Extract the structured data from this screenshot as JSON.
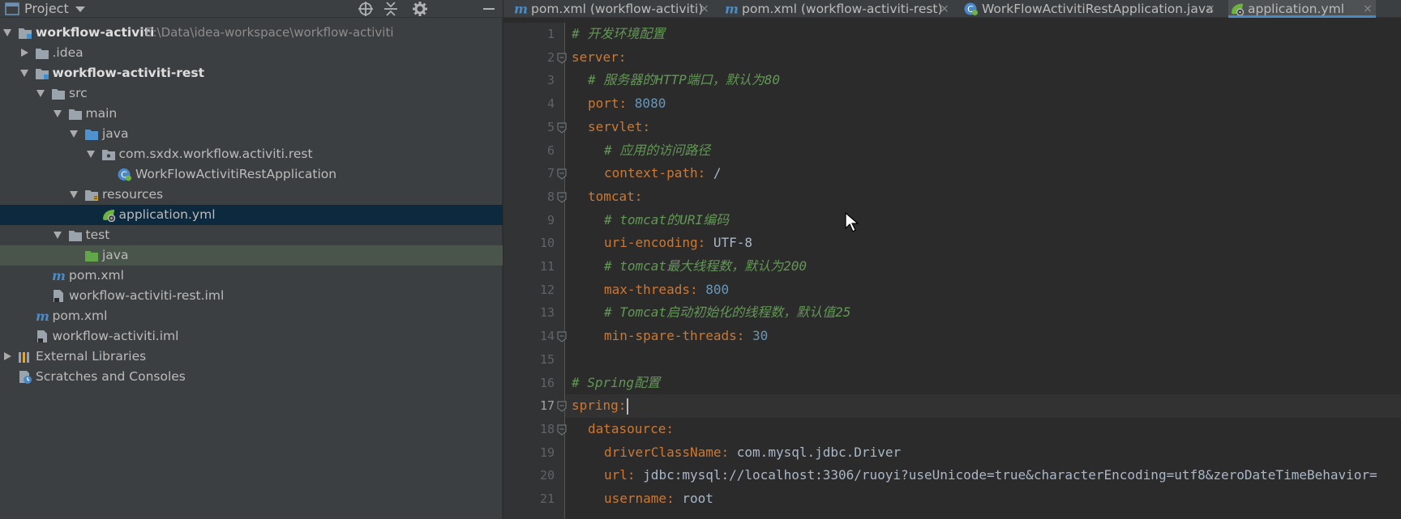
{
  "project_panel": {
    "title": "Project",
    "tree": [
      {
        "label": "workflow-activiti",
        "path": "E:\\Data\\idea-workspace\\workflow-activiti",
        "bold": true,
        "indent": 0,
        "arrow": "down",
        "icon": "module-folder-icon"
      },
      {
        "label": ".idea",
        "indent": 1,
        "arrow": "right",
        "icon": "folder-icon"
      },
      {
        "label": "workflow-activiti-rest",
        "bold": true,
        "indent": 1,
        "arrow": "down",
        "icon": "module-folder-icon"
      },
      {
        "label": "src",
        "indent": 2,
        "arrow": "down",
        "icon": "folder-icon"
      },
      {
        "label": "main",
        "indent": 3,
        "arrow": "down",
        "icon": "folder-icon"
      },
      {
        "label": "java",
        "indent": 4,
        "arrow": "down",
        "icon": "source-folder-icon"
      },
      {
        "label": "com.sxdx.workflow.activiti.rest",
        "indent": 5,
        "arrow": "down",
        "icon": "package-icon"
      },
      {
        "label": "WorkFlowActivitiRestApplication",
        "indent": 6,
        "arrow": "none",
        "icon": "spring-boot-class-icon"
      },
      {
        "label": "resources",
        "indent": 4,
        "arrow": "down",
        "icon": "resources-folder-icon"
      },
      {
        "label": "application.yml",
        "indent": 5,
        "arrow": "none",
        "icon": "spring-yml-icon",
        "selected": true
      },
      {
        "label": "test",
        "indent": 3,
        "arrow": "down",
        "icon": "folder-icon"
      },
      {
        "label": "java",
        "indent": 4,
        "arrow": "none",
        "icon": "test-folder-icon",
        "highlight": true
      },
      {
        "label": "pom.xml",
        "indent": 2,
        "arrow": "none",
        "icon": "maven-icon"
      },
      {
        "label": "workflow-activiti-rest.iml",
        "indent": 2,
        "arrow": "none",
        "icon": "iml-file-icon"
      },
      {
        "label": "pom.xml",
        "indent": 1,
        "arrow": "none",
        "icon": "maven-icon"
      },
      {
        "label": "workflow-activiti.iml",
        "indent": 1,
        "arrow": "none",
        "icon": "iml-file-icon"
      },
      {
        "label": "External Libraries",
        "indent": 0,
        "arrow": "right",
        "icon": "libraries-icon"
      },
      {
        "label": "Scratches and Consoles",
        "indent": 0,
        "arrow": "none",
        "icon": "scratches-icon"
      }
    ]
  },
  "tabs": [
    {
      "label": "pom.xml (workflow-activiti)",
      "icon": "maven-icon",
      "active": false
    },
    {
      "label": "pom.xml (workflow-activiti-rest)",
      "icon": "maven-icon",
      "active": false
    },
    {
      "label": "WorkFlowActivitiRestApplication.java",
      "icon": "spring-boot-class-icon",
      "active": false
    },
    {
      "label": "application.yml",
      "icon": "spring-yml-icon",
      "active": true
    }
  ],
  "tab_close_glyph": "×",
  "editor": {
    "current_line": 17,
    "lines": [
      {
        "n": "1",
        "indent": 0,
        "parts": [
          [
            "comment",
            "# 开发环境配置"
          ]
        ]
      },
      {
        "n": "2",
        "indent": 0,
        "fold": true,
        "parts": [
          [
            "key",
            "server"
          ],
          [
            "punc",
            ":"
          ]
        ]
      },
      {
        "n": "3",
        "indent": 1,
        "parts": [
          [
            "comment",
            "# 服务器的HTTP端口，默认为80"
          ]
        ]
      },
      {
        "n": "4",
        "indent": 1,
        "parts": [
          [
            "key",
            "port"
          ],
          [
            "punc",
            ": "
          ],
          [
            "num",
            "8080"
          ]
        ]
      },
      {
        "n": "5",
        "indent": 1,
        "fold": true,
        "parts": [
          [
            "key",
            "servlet"
          ],
          [
            "punc",
            ":"
          ]
        ]
      },
      {
        "n": "6",
        "indent": 2,
        "parts": [
          [
            "comment",
            "# 应用的访问路径"
          ]
        ]
      },
      {
        "n": "7",
        "indent": 2,
        "fold": true,
        "parts": [
          [
            "key",
            "context-path"
          ],
          [
            "punc",
            ": "
          ],
          [
            "val",
            "/"
          ]
        ]
      },
      {
        "n": "8",
        "indent": 1,
        "fold": true,
        "parts": [
          [
            "key",
            "tomcat"
          ],
          [
            "punc",
            ":"
          ]
        ]
      },
      {
        "n": "9",
        "indent": 2,
        "parts": [
          [
            "comment",
            "# tomcat的URI编码"
          ]
        ]
      },
      {
        "n": "10",
        "indent": 2,
        "parts": [
          [
            "key",
            "uri-encoding"
          ],
          [
            "punc",
            ": "
          ],
          [
            "val",
            "UTF-8"
          ]
        ]
      },
      {
        "n": "11",
        "indent": 2,
        "parts": [
          [
            "comment",
            "# tomcat最大线程数，默认为200"
          ]
        ]
      },
      {
        "n": "12",
        "indent": 2,
        "parts": [
          [
            "key",
            "max-threads"
          ],
          [
            "punc",
            ": "
          ],
          [
            "num",
            "800"
          ]
        ]
      },
      {
        "n": "13",
        "indent": 2,
        "parts": [
          [
            "comment",
            "# Tomcat启动初始化的线程数，默认值25"
          ]
        ]
      },
      {
        "n": "14",
        "indent": 2,
        "fold": true,
        "parts": [
          [
            "key",
            "min-spare-threads"
          ],
          [
            "punc",
            ": "
          ],
          [
            "num",
            "30"
          ]
        ]
      },
      {
        "n": "15",
        "indent": 0,
        "parts": []
      },
      {
        "n": "16",
        "indent": 0,
        "parts": [
          [
            "comment",
            "# Spring配置"
          ]
        ]
      },
      {
        "n": "17",
        "indent": 0,
        "fold": true,
        "caret": true,
        "parts": [
          [
            "key",
            "spring"
          ],
          [
            "punc",
            ":"
          ]
        ]
      },
      {
        "n": "18",
        "indent": 1,
        "fold": true,
        "parts": [
          [
            "key",
            "datasource"
          ],
          [
            "punc",
            ":"
          ]
        ]
      },
      {
        "n": "19",
        "indent": 2,
        "parts": [
          [
            "key",
            "driverClassName"
          ],
          [
            "punc",
            ": "
          ],
          [
            "pkg",
            "com"
          ],
          [
            "dot",
            "."
          ],
          [
            "pkg",
            "mysql"
          ],
          [
            "dot",
            "."
          ],
          [
            "pkg",
            "jdbc"
          ],
          [
            "dot",
            "."
          ],
          [
            "val",
            "Driver"
          ]
        ]
      },
      {
        "n": "20",
        "indent": 2,
        "parts": [
          [
            "key",
            "url"
          ],
          [
            "punc",
            ": "
          ],
          [
            "val",
            "jdbc:mysql://localhost:3306/ruoyi?useUnicode=true&characterEncoding=utf8&zeroDateTimeBehavior="
          ]
        ]
      },
      {
        "n": "21",
        "indent": 2,
        "parts": [
          [
            "key",
            "username"
          ],
          [
            "punc",
            ": "
          ],
          [
            "val",
            "root"
          ]
        ]
      }
    ]
  },
  "colors": {
    "comment": "#629755",
    "key": "#cc7832",
    "number": "#6897bb",
    "value": "#a9b7c6",
    "selection": "#0d293e",
    "accent": "#4a88c7"
  }
}
